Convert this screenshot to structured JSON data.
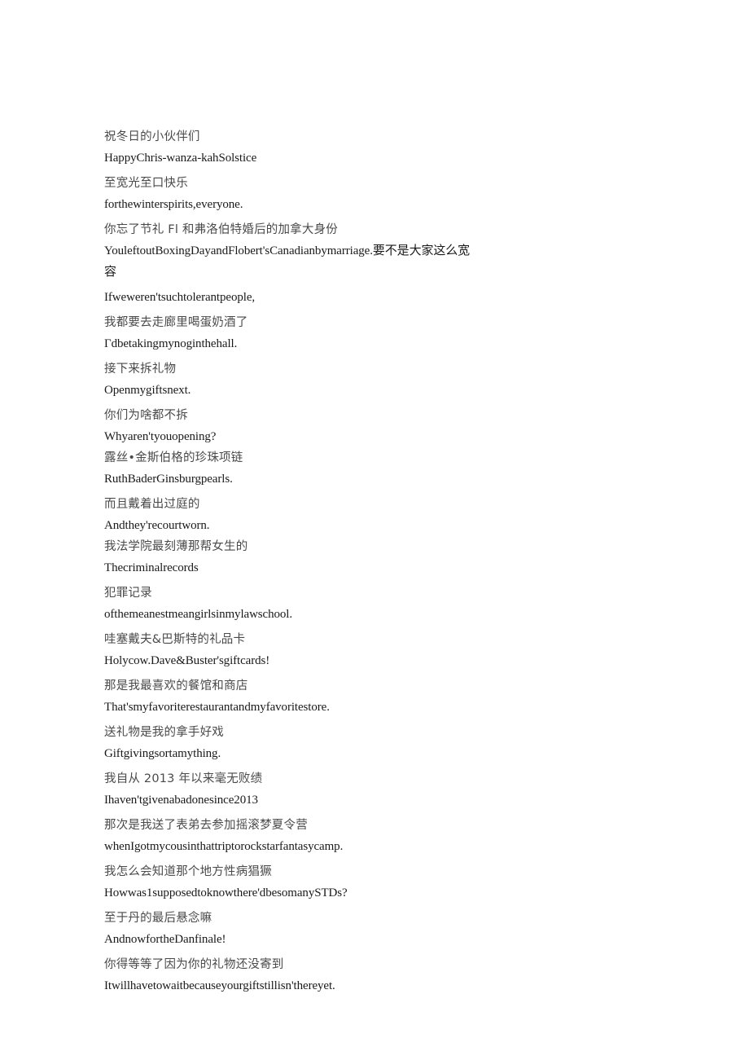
{
  "document": {
    "kind": "bilingual-subtitle-transcript",
    "page_background": "#ffffff",
    "zh_text_color": "#4a4a4a",
    "en_text_color": "#1a1a1a",
    "cues": [
      {
        "zh": "祝冬日的小伙伴们",
        "en": "HappyChris-wanza-kahSolstice",
        "tight": false
      },
      {
        "zh": "至宽光至口快乐",
        "en": "forthewinterspirits,everyone.",
        "tight": false
      },
      {
        "zh": "你忘了节礼 Fl 和弗洛伯特婚后的加拿大身份",
        "en": "YouleftoutBoxingDayandFlobert'sCanadianbymarriage.要不是大家这么宽容",
        "tight": false
      },
      {
        "zh": "",
        "en": "Ifweweren'tsuchtolerantpeople,",
        "tight": false
      },
      {
        "zh": "我都要去走廊里喝蛋奶酒了",
        "en": "Γdbetakingmynoginthehall.",
        "tight": false
      },
      {
        "zh": "接下来拆礼物",
        "en": "Openmygiftsnext.",
        "tight": false
      },
      {
        "zh": "你们为啥都不拆",
        "en": "Whyaren'tyouopening?",
        "tight": true
      },
      {
        "zh": "露丝•金斯伯格的珍珠项链",
        "en": "RuthBaderGinsburgpearls.",
        "tight": false
      },
      {
        "zh": "而且戴着出过庭的",
        "en": "Andthey'recourtworn.",
        "tight": true
      },
      {
        "zh": "我法学院最刻薄那帮女生的",
        "en": "Thecriminalrecords",
        "tight": false
      },
      {
        "zh": "犯罪记录",
        "en": "ofthemeanestmeangirlsinmylawschool.",
        "tight": false
      },
      {
        "zh": "哇塞戴夫&巴斯特的礼品卡",
        "en": "Holycow.Dave&Buster'sgiftcards!",
        "tight": false
      },
      {
        "zh": "那是我最喜欢的餐馆和商店",
        "en": "That'smyfavoriterestaurantandmyfavoritestore.",
        "tight": false
      },
      {
        "zh": "送礼物是我的拿手好戏",
        "en": "Giftgivingsortamything.",
        "tight": false
      },
      {
        "zh": "我自从 2013 年以来毫无败绩",
        "en": "Ihaven'tgivenabadonesince2013",
        "tight": false
      },
      {
        "zh": "那次是我送了表弟去参加摇滚梦夏令营",
        "en": "whenIgotmycousinthattriptorockstarfantasycamp.",
        "tight": false
      },
      {
        "zh": "我怎么会知道那个地方性病猖獗",
        "en": "Howwas1supposedtoknowthere'dbesomanySTDs?",
        "tight": false
      },
      {
        "zh": "至于丹的最后悬念嘛",
        "en": "AndnowfortheDanfinale!",
        "tight": false
      },
      {
        "zh": "你得等等了因为你的礼物还没寄到",
        "en": "Itwillhavetowaitbecauseyourgiftstillisn'thereyet.",
        "tight": false
      }
    ]
  }
}
